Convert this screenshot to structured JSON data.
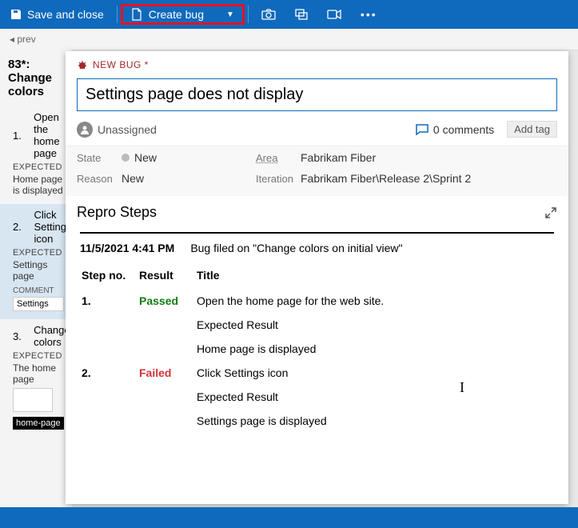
{
  "toolbar": {
    "save_close": "Save and close",
    "create_bug": "Create bug"
  },
  "breadcrumb": {
    "prev": "prev"
  },
  "left": {
    "title": "83*: Change colors",
    "steps": [
      {
        "num": "1.",
        "title": "Open the home page",
        "expected_lbl": "EXPECTED",
        "expected": "Home page is displayed"
      },
      {
        "num": "2.",
        "title": "Click Settings icon",
        "expected_lbl": "EXPECTED",
        "expected": "Settings page",
        "comment_lbl": "COMMENT",
        "comment": "Settings"
      },
      {
        "num": "3.",
        "title": "Change colors",
        "expected_lbl": "EXPECTED",
        "expected": "The home page"
      }
    ],
    "black": "home-page"
  },
  "bug": {
    "type": "NEW BUG *",
    "title_value": "Settings page does not display",
    "unassigned": "Unassigned",
    "comments": "0 comments",
    "add_tag": "Add tag",
    "fields": {
      "state_lbl": "State",
      "state": "New",
      "reason_lbl": "Reason",
      "reason": "New",
      "area_lbl": "Area",
      "area": "Fabrikam Fiber",
      "iteration_lbl": "Iteration",
      "iteration": "Fabrikam Fiber\\Release 2\\Sprint 2"
    }
  },
  "repro": {
    "title": "Repro Steps",
    "timestamp": "11/5/2021 4:41 PM",
    "filed_on": "Bug filed on \"Change colors on initial view\"",
    "headers": {
      "step": "Step no.",
      "result": "Result",
      "title": "Title"
    },
    "steps": [
      {
        "num": "1.",
        "result": "Passed",
        "result_class": "passed",
        "title": "Open the home page for the web site.",
        "expected_lbl": "Expected Result",
        "expected": "Home page is displayed"
      },
      {
        "num": "2.",
        "result": "Failed",
        "result_class": "failed",
        "title": "Click Settings icon",
        "expected_lbl": "Expected Result",
        "expected": "Settings page is displayed"
      }
    ]
  }
}
